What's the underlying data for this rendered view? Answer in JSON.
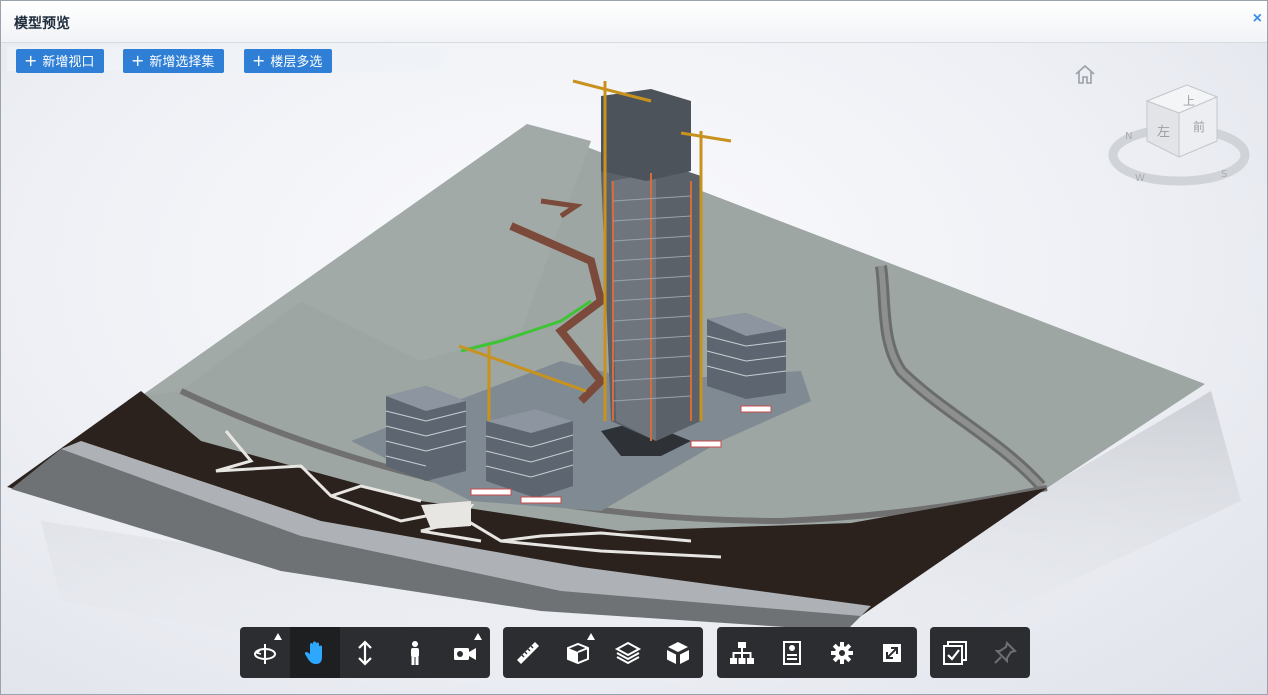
{
  "window": {
    "title": "模型预览",
    "close_glyph": "×"
  },
  "top_buttons": [
    {
      "label": "新增视口",
      "icon": "plus-icon"
    },
    {
      "label": "新增选择集",
      "icon": "plus-icon"
    },
    {
      "label": "楼层多选",
      "icon": "plus-icon"
    }
  ],
  "viewcube": {
    "faces": {
      "top": "上",
      "left": "左",
      "front": "前"
    },
    "compass": {
      "n": "N",
      "w": "W",
      "s": "S"
    }
  },
  "toolbar_groups": [
    [
      {
        "icon": "orbit-icon",
        "has_menu": true,
        "active": false
      },
      {
        "icon": "pan-hand-icon",
        "has_menu": false,
        "active": true
      },
      {
        "icon": "zoom-updown-icon",
        "has_menu": false,
        "active": false
      },
      {
        "icon": "walk-person-icon",
        "has_menu": false,
        "active": false
      },
      {
        "icon": "camera-icon",
        "has_menu": true,
        "active": false
      }
    ],
    [
      {
        "icon": "measure-ruler-icon",
        "has_menu": false,
        "active": false
      },
      {
        "icon": "section-box-icon",
        "has_menu": true,
        "active": false
      },
      {
        "icon": "layers-icon",
        "has_menu": false,
        "active": false
      },
      {
        "icon": "explode-cube-icon",
        "has_menu": false,
        "active": false
      }
    ],
    [
      {
        "icon": "model-tree-icon",
        "has_menu": false,
        "active": false
      },
      {
        "icon": "properties-icon",
        "has_menu": false,
        "active": false
      },
      {
        "icon": "settings-gear-icon",
        "has_menu": false,
        "active": false
      },
      {
        "icon": "fullscreen-icon",
        "has_menu": false,
        "active": false
      }
    ],
    [
      {
        "icon": "check-select-icon",
        "has_menu": false,
        "active": false
      },
      {
        "icon": "pin-icon",
        "has_menu": false,
        "active": false
      }
    ]
  ],
  "colors": {
    "accent": "#2f7fd6",
    "toolbar_bg": "#2b2d30",
    "icon": "#ffffff",
    "active_icon": "#2ea7ff",
    "ground": "#9aa3a0",
    "road": "#2a211d"
  }
}
